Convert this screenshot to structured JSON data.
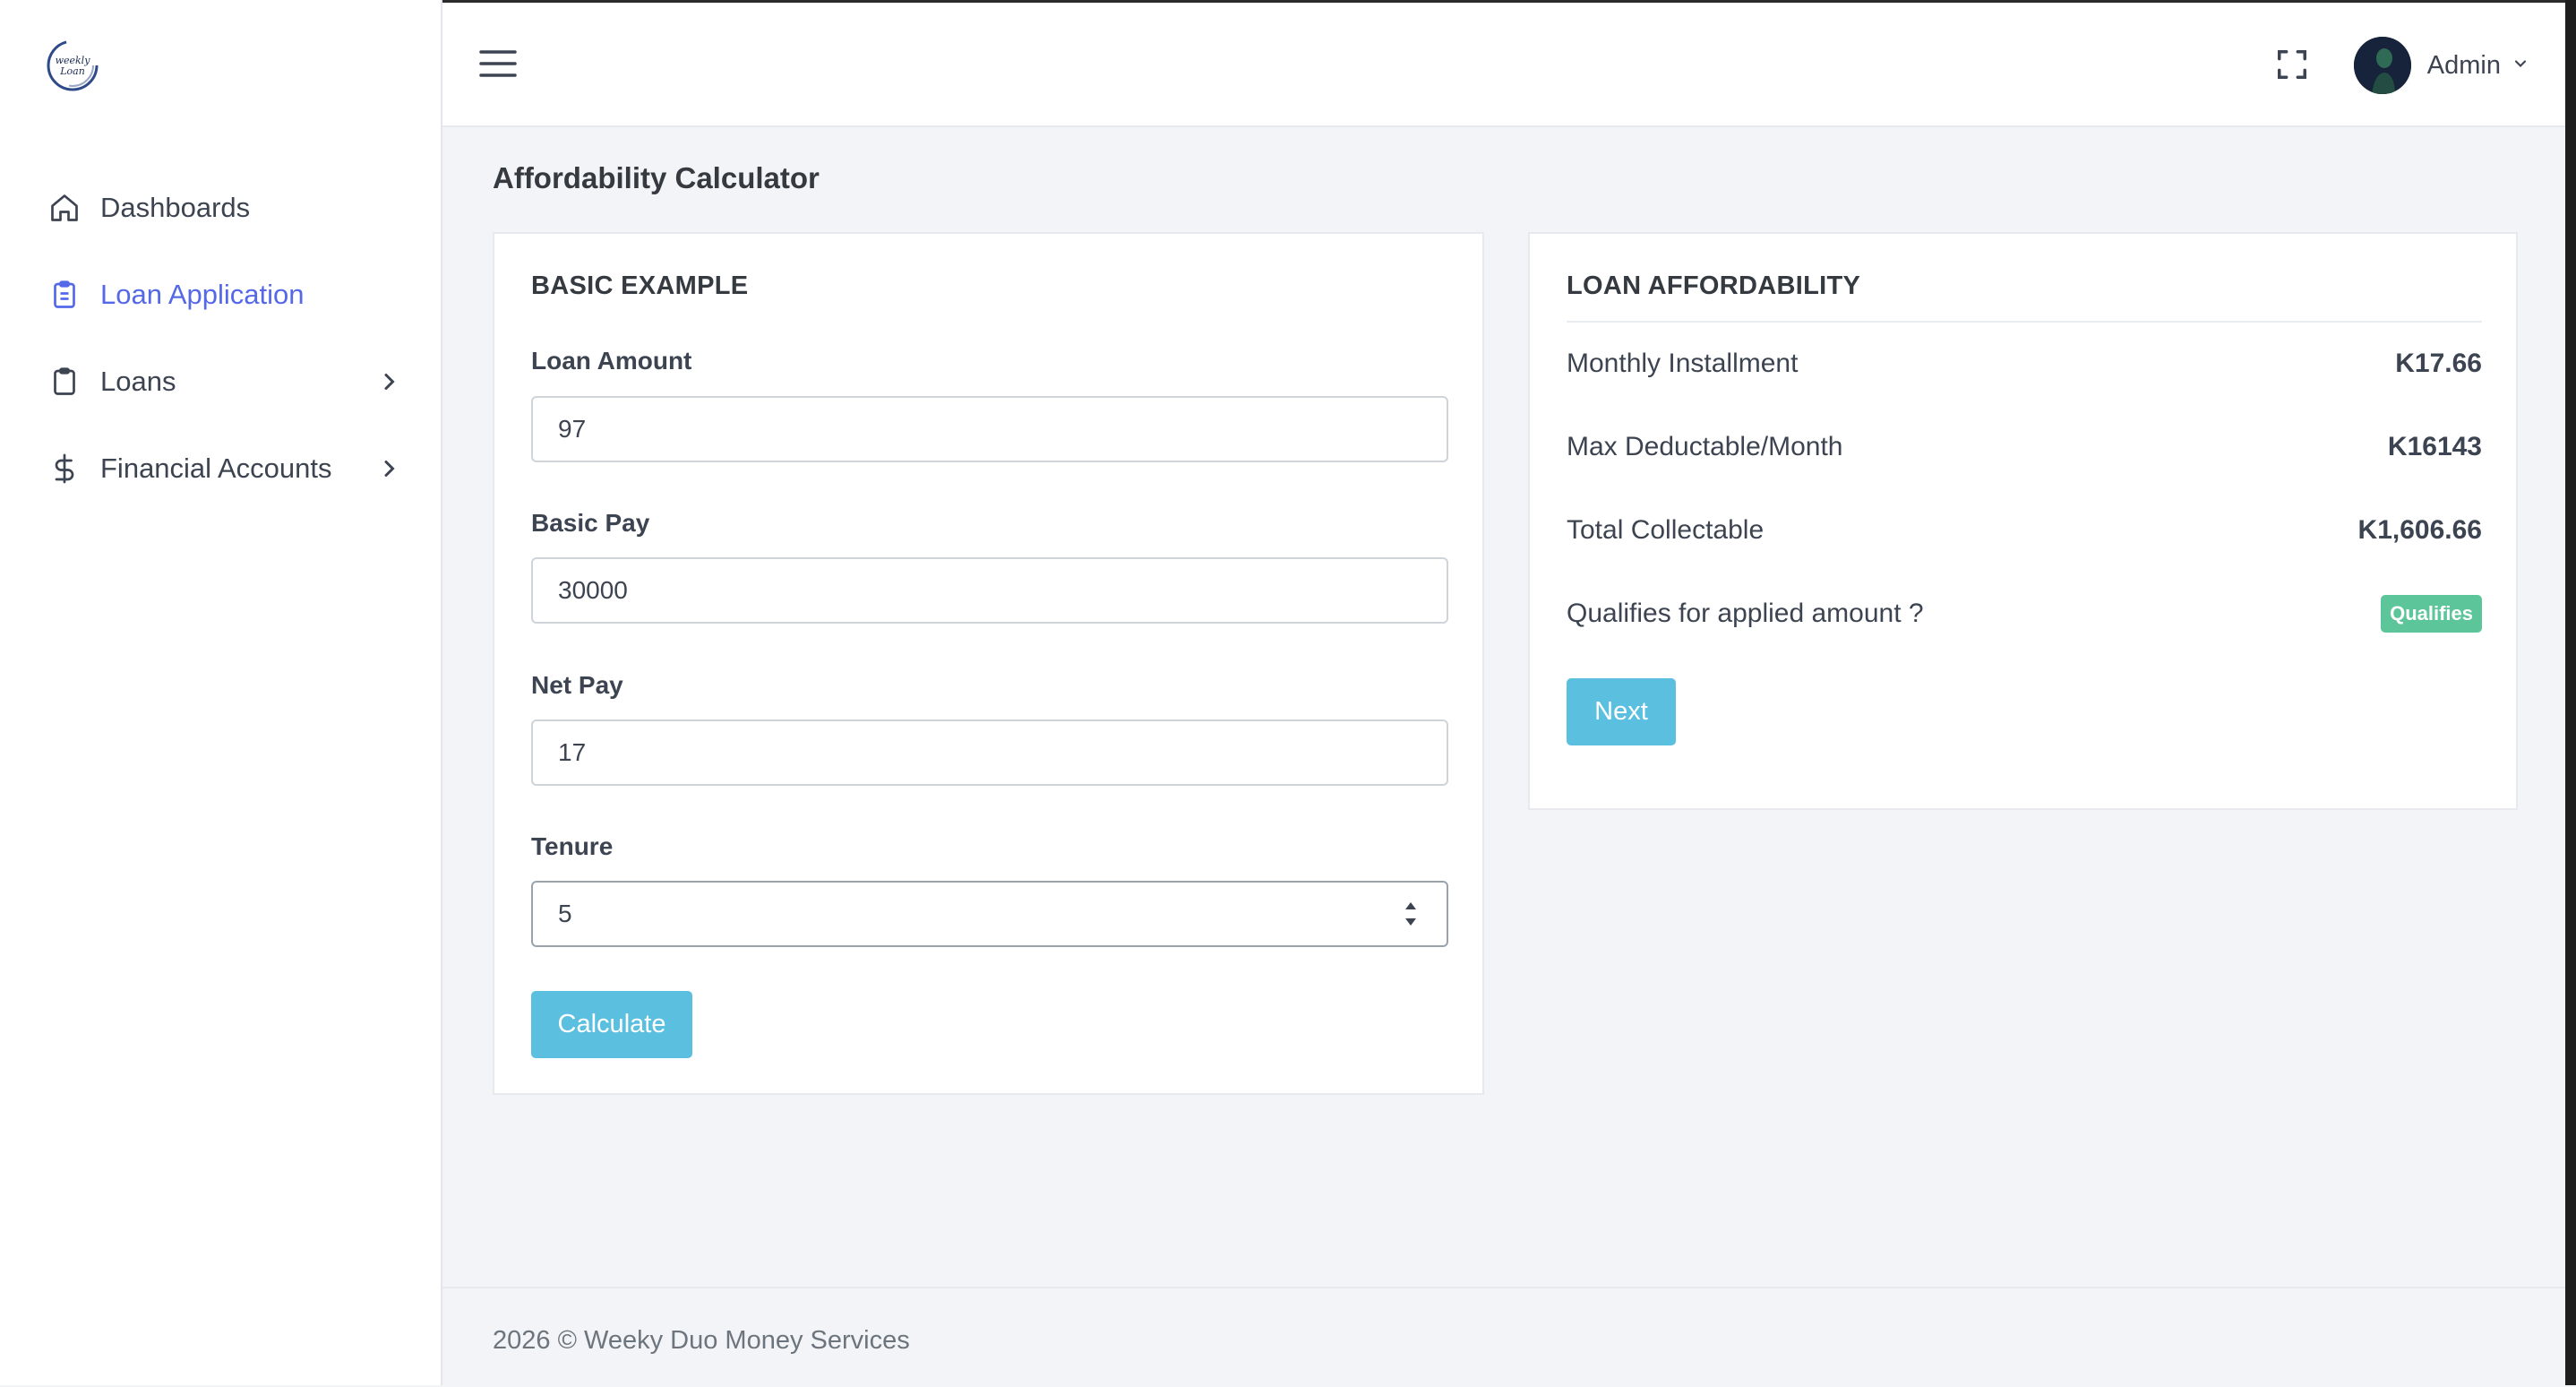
{
  "logo": {
    "text": "weekly Loan"
  },
  "sidebar": {
    "items": [
      {
        "label": "Dashboards",
        "icon": "home-icon",
        "active": false,
        "has_submenu": false
      },
      {
        "label": "Loan Application",
        "icon": "clipboard-list-icon",
        "active": true,
        "has_submenu": false
      },
      {
        "label": "Loans",
        "icon": "clipboard-icon",
        "active": false,
        "has_submenu": true
      },
      {
        "label": "Financial Accounts",
        "icon": "dollar-icon",
        "active": false,
        "has_submenu": true
      }
    ]
  },
  "topbar": {
    "menu_icon": "hamburger-icon",
    "fullscreen_icon": "fullscreen-icon",
    "user": {
      "name": "Admin",
      "dropdown_icon": "chevron-down-icon"
    }
  },
  "page": {
    "title": "Affordability Calculator"
  },
  "calculator": {
    "title": "BASIC EXAMPLE",
    "fields": [
      {
        "label": "Loan Amount",
        "value": "97"
      },
      {
        "label": "Basic Pay",
        "value": "30000"
      },
      {
        "label": "Net Pay",
        "value": "17"
      },
      {
        "label": "Tenure",
        "value": "5"
      }
    ],
    "calculate_label": "Calculate"
  },
  "affordability": {
    "title": "LOAN AFFORDABILITY",
    "rows": [
      {
        "label": "Monthly Installment",
        "value": "K17.66"
      },
      {
        "label": "Max Deductable/Month",
        "value": "K16143"
      },
      {
        "label": "Total Collectable",
        "value": "K1,606.66"
      },
      {
        "label": "Qualifies for applied amount ?",
        "badge": "Qualifies"
      }
    ],
    "next_label": "Next"
  },
  "footer": {
    "text": "2026 © Weeky Duo Money Services"
  },
  "colors": {
    "accent": "#5468e8",
    "button": "#5bbfe0",
    "success": "#5dc59a",
    "background": "#f3f4f7"
  }
}
